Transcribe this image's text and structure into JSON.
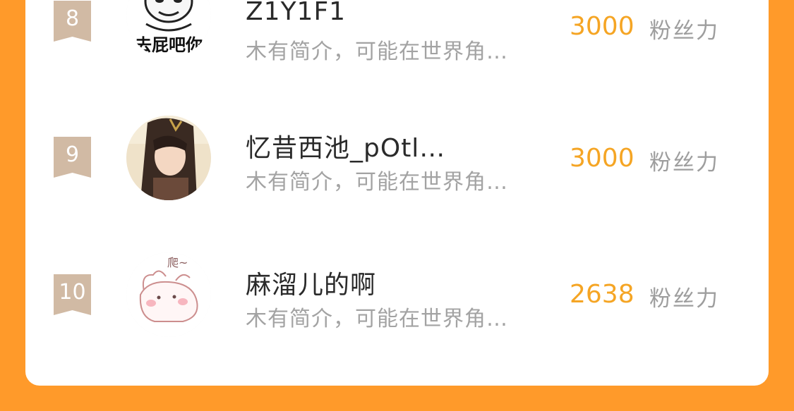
{
  "leaderboard": {
    "rows": [
      {
        "rank": "8",
        "name": "Z1Y1F1",
        "bio": "木有简介，可能在世界角…",
        "score": "3000",
        "unit": "粉丝力",
        "avatar_text": "去屁吧你",
        "avatar_icon": "meme-face-avatar"
      },
      {
        "rank": "9",
        "name": "忆昔西池_pOtl…",
        "bio": "木有简介，可能在世界角…",
        "score": "3000",
        "unit": "粉丝力",
        "avatar_icon": "anime-portrait-avatar"
      },
      {
        "rank": "10",
        "name": "麻溜儿的啊",
        "bio": "木有简介，可能在世界角…",
        "score": "2638",
        "unit": "粉丝力",
        "avatar_text": "爬~",
        "avatar_icon": "bunny-sticker-avatar"
      }
    ]
  },
  "colors": {
    "background": "#FF9A2A",
    "score": "#F5A524",
    "badge": "#D1BAA4"
  }
}
